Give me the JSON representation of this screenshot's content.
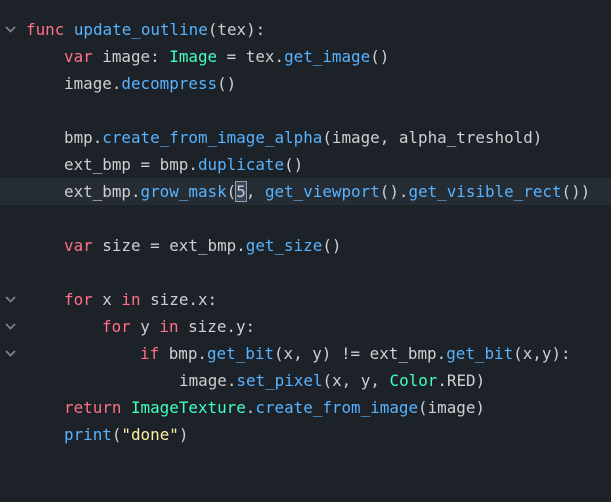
{
  "colors": {
    "background": "#1d2229",
    "current_line": "#262c34",
    "text": "#cdcfd2",
    "keyword": "#ff7085",
    "function": "#57b3ff",
    "type": "#42ffc2",
    "string": "#ffeda1",
    "fold_arrow": "#7c8288"
  },
  "icons": {
    "fold": "chevron-down-icon"
  },
  "code": {
    "line1": {
      "kw": "func",
      "name": "update_outline",
      "rest": "(tex):"
    },
    "line2": {
      "kw": "var",
      "a": " image: ",
      "type": "Image",
      "b": " = tex.",
      "fn": "get_image",
      "c": "()"
    },
    "line3": {
      "a": "image.",
      "fn": "decompress",
      "b": "()"
    },
    "line5": {
      "a": "bmp.",
      "fn": "create_from_image_alpha",
      "b": "(image, alpha_treshold)"
    },
    "line6": {
      "a": "ext_bmp = bmp.",
      "fn": "duplicate",
      "b": "()"
    },
    "line7": {
      "a": "ext_bmp.",
      "fn1": "grow_mask",
      "b": "(",
      "caret_char": "5",
      "c": ", ",
      "fn2": "get_viewport",
      "d": "().",
      "fn3": "get_visible_rect",
      "e": "())"
    },
    "line9": {
      "kw": "var",
      "a": " size = ext_bmp.",
      "fn": "get_size",
      "b": "()"
    },
    "line11": {
      "kw1": "for",
      "a": " x ",
      "kw2": "in",
      "b": " size.x:"
    },
    "line12": {
      "kw1": "for",
      "a": " y ",
      "kw2": "in",
      "b": " size.y:"
    },
    "line13": {
      "kw": "if",
      "a": " bmp.",
      "fn1": "get_bit",
      "b": "(x, y) != ext_bmp.",
      "fn2": "get_bit",
      "c": "(x,y):"
    },
    "line14": {
      "a": "image.",
      "fn": "set_pixel",
      "b": "(x, y, ",
      "type": "Color",
      "c": ".RED)"
    },
    "line15": {
      "kw": "return",
      "sp": " ",
      "type": "ImageTexture",
      "a": ".",
      "fn": "create_from_image",
      "b": "(image)"
    },
    "line16": {
      "fn": "print",
      "a": "(",
      "str": "\"done\"",
      "b": ")"
    }
  }
}
